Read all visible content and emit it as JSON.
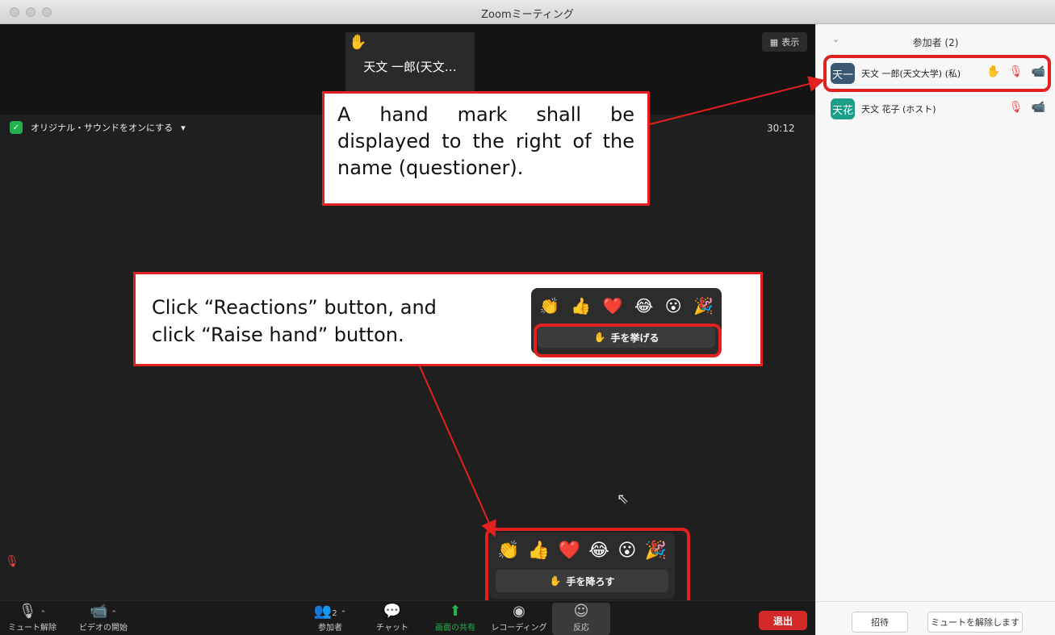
{
  "window": {
    "title": "Zoomミーティング"
  },
  "video": {
    "tile_name": "天文 一郎(天文…",
    "view_label": "表示",
    "sound_label": "オリジナル・サウンドをオンにする",
    "timer": "30:12"
  },
  "annotations": {
    "hand_note": "A hand mark shall be displayed to the right of the name (questioner).",
    "click_line1": "Click “Reactions” button, and",
    "click_line2": "click “Raise hand” button."
  },
  "reactions": {
    "emojis": [
      "👏",
      "👍",
      "❤️",
      "😂",
      "😮",
      "🎉"
    ],
    "raise_hand": "手を挙げる",
    "lower_hand": "手を降ろす"
  },
  "controls": {
    "unmute": "ミュート解除",
    "start_video": "ビデオの開始",
    "participants": "参加者",
    "participants_count": "2",
    "chat": "チャット",
    "share": "画面の共有",
    "record": "レコーディング",
    "reactions": "反応",
    "leave": "退出"
  },
  "panel": {
    "title": "参加者 (2)",
    "participants": [
      {
        "avatar": "天一",
        "name": "天文 一郎(天文大学)  (私)",
        "color": "#3b5872"
      },
      {
        "avatar": "天花",
        "name": "天文 花子 (ホスト)",
        "color": "#1a9e8a"
      }
    ],
    "invite": "招待",
    "unmute_all": "ミュートを解除します"
  }
}
